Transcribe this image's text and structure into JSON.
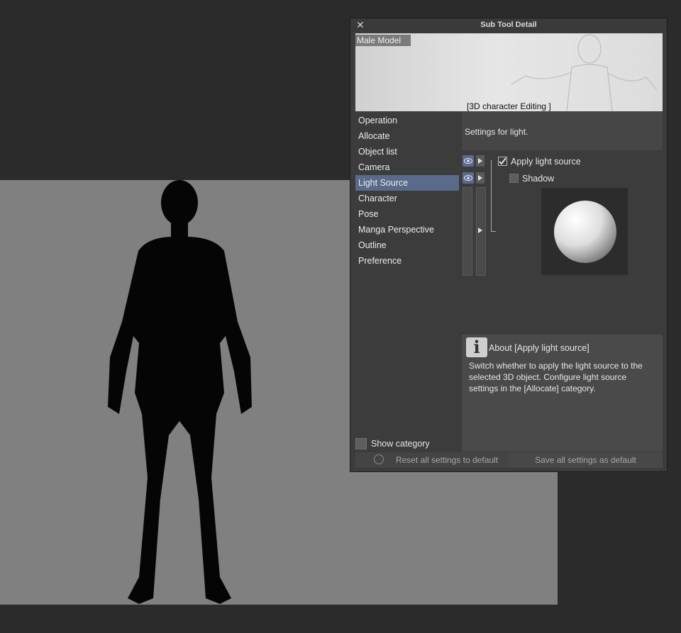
{
  "window": {
    "title": "Sub Tool Detail",
    "close_icon": "close-icon"
  },
  "preview": {
    "label": "Male Model",
    "caption": "[3D character Editing ]"
  },
  "categories": [
    "Operation",
    "Allocate",
    "Object list",
    "Camera",
    "Light Source",
    "Character",
    "Pose",
    "Manga Perspective",
    "Outline",
    "Preference"
  ],
  "active_category": "Light Source",
  "settings_header": "Settings for light.",
  "options": {
    "apply_light": {
      "label": "Apply light source",
      "checked": true
    },
    "shadow": {
      "label": "Shadow",
      "checked": false
    }
  },
  "info": {
    "title": "About [Apply light source]",
    "text": "Switch whether to apply the light source to the selected 3D object. Configure light source settings in the [Allocate] category."
  },
  "show_category": {
    "label": "Show category",
    "checked": false
  },
  "footer": {
    "reset_label": "Reset all settings to default",
    "save_label": "Save all settings as default"
  },
  "colors": {
    "accent": "#5a6a8a",
    "canvas": "#808080",
    "background": "#2b2b2b"
  }
}
